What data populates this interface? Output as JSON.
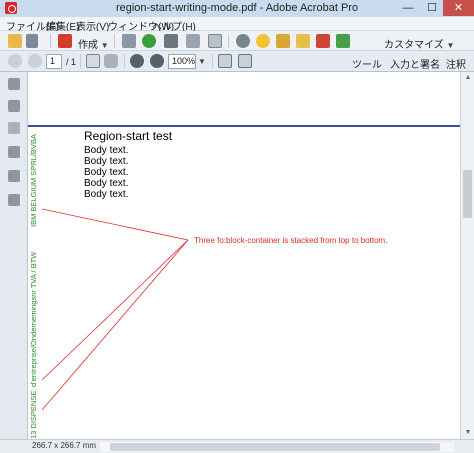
{
  "window": {
    "title": "region-start-writing-mode.pdf - Adobe Acrobat Pro",
    "minimize": "—",
    "maximize": "☐",
    "close": "✕"
  },
  "menu": [
    "ファイル(F)",
    "編集(E)",
    "表示(V)",
    "ウィンドウ(W)",
    "ヘルプ(H)"
  ],
  "toolbar1": {
    "create_label": "作成",
    "customize_label": "カスタマイズ"
  },
  "toolbar2": {
    "page_current": "1",
    "page_total": "/ 1",
    "zoom": "100%",
    "tools": "ツール",
    "fill_sign": "入力と署名",
    "comment": "注釈"
  },
  "document": {
    "region_title": "Region-start test",
    "body_lines": [
      "Body text.",
      "Body text.",
      "Body text.",
      "Body text.",
      "Body text."
    ],
    "vertical_texts": [
      "IBM BELGIUM SPRL/BVBA",
      "d'entreprise/Ondernemingsnr TVA / BTW",
      "13 DISPENSE"
    ],
    "annotation": "Three fo:block-container is stacked from top to bottom."
  },
  "status": {
    "page_size": "266.7 x 266.7 mm"
  },
  "colors": {
    "accent_red": "#e0282a",
    "vertical_green": "#2a8a2a",
    "rule_blue": "#3d4a9a"
  }
}
